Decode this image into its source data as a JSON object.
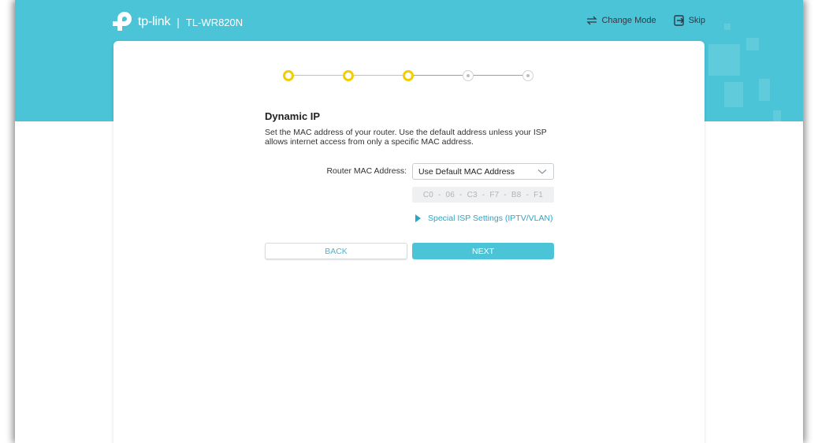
{
  "header": {
    "brand": "tp-link",
    "separator": "|",
    "model": "TL-WR820N",
    "actions": [
      {
        "label": "Change Mode",
        "icon": "swap-arrows-icon"
      },
      {
        "label": "Skip",
        "icon": "exit-icon"
      }
    ]
  },
  "stepper": {
    "total_steps": 5,
    "completed_steps": 3,
    "colors": {
      "done": "#f5cc00",
      "todo": "#cfd4d8"
    }
  },
  "section": {
    "title": "Dynamic IP",
    "description": "Set the MAC address of your router. Use the default address unless your ISP allows internet access from only a specific MAC address."
  },
  "form": {
    "mac_label": "Router MAC Address:",
    "mac_select_value": "Use Default MAC Address",
    "mac_octets": [
      "C0",
      "06",
      "C3",
      "F7",
      "B8",
      "F1"
    ],
    "mac_separator": "-",
    "special_isp_link": "Special ISP Settings (IPTV/VLAN)"
  },
  "buttons": {
    "back": "BACK",
    "next": "NEXT"
  },
  "theme": {
    "accent": "#4bc4d7",
    "link": "#2aa5c9"
  }
}
